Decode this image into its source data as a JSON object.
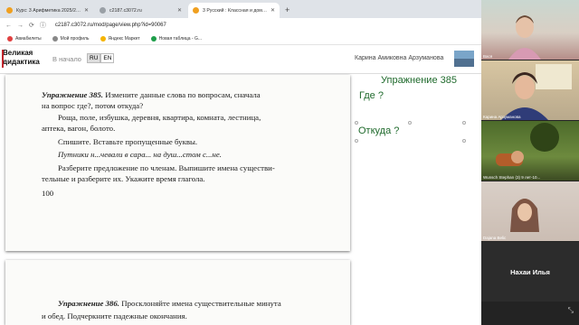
{
  "browser": {
    "tabs": [
      {
        "title": "Курс: 3 Арифметика 2025/26 ...",
        "active": false,
        "favicon_color": "#f0a020"
      },
      {
        "title": "c2187.c3072.ru",
        "active": false,
        "favicon_color": "#9aa0a6"
      },
      {
        "title": "3 Русский : Класcная и домаш...",
        "active": true,
        "favicon_color": "#f0a020"
      }
    ],
    "new_tab_label": "+",
    "url": "c2187.c3072.ru/mod/page/view.php?id=90067",
    "bookmarks": [
      {
        "label": "Авиабилеты",
        "color": "#e04040"
      },
      {
        "label": "Мой профиль",
        "color": "#888888"
      },
      {
        "label": "Яндекс Маркет",
        "color": "#f5b400"
      },
      {
        "label": "Новая таблица - G...",
        "color": "#1e9e4a"
      }
    ]
  },
  "site": {
    "logo_line1": "Великая",
    "logo_line2": "дидактика",
    "home_link": "В начало",
    "lang_ru": "RU",
    "lang_en": "EN",
    "user_name": "Карина Амиковна Арзуманова"
  },
  "book": {
    "ex385_label": "Упражнение 385.",
    "ex385_line1": "Измените данные слова по вопросам, сначала",
    "ex385_line2": "на вопрос где?, потом откуда?",
    "words_line1": "Роща, поле, избушка, деревня, квартира, комната, лестница,",
    "words_line2": "аптека, вагон, болото.",
    "task_copy": "Спишите. Вставьте пропущенные буквы.",
    "sentence": "Путники н...чевали в сара... на душ...стом с...не.",
    "task_parse_1": "Разберите предложение по членам. Выпишите имена существи-",
    "task_parse_2": "тельные и разберите их. Укажите время глагола.",
    "page_number": "100",
    "ex386_label": "Упражнение 386.",
    "ex386_line1": "Просклоняйте имена существительные минута",
    "ex386_line2": "и обед. Подчеркните падежные окончания."
  },
  "notes": {
    "heading": "Упражнение 385",
    "where": "Где ?",
    "from_where": "Откуда ?"
  },
  "video": {
    "participants": [
      {
        "name": "Вася"
      },
      {
        "name": "Карина Арзуманова"
      },
      {
        "name": "Wunsch Stephan (3) 9 лет-10..."
      },
      {
        "name": "Dajana Belic"
      },
      {
        "name": "Нахаи Илья"
      }
    ]
  }
}
